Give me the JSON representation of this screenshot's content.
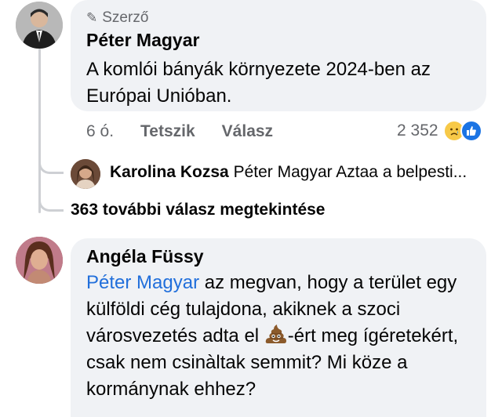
{
  "comments": [
    {
      "badge": "Szerző",
      "author": "Péter Magyar",
      "text": "A komlói bányák környezete 2024-ben az Európai Unióban.",
      "time": "6 ó.",
      "like_label": "Tetszik",
      "reply_label": "Válasz",
      "reaction_count": "2 352",
      "reactions": [
        "sad-icon",
        "like-icon"
      ],
      "reply_preview": {
        "author": "Karolina Kozsa",
        "text": "Péter Magyar Aztaa a belpesti..."
      },
      "more_replies": "363 további válasz megtekintése"
    },
    {
      "author": "Angéla Füssy",
      "mention": "Péter Magyar",
      "text_part1": " az megvan, hogy a terület egy külföldi cég tulajdona, akiknek a szoci városvezetés adta el ",
      "text_part2": "-ért meg ígéretekért, csak nem csinàltak semmit? Mi köze a kormánynak ehhez?"
    }
  ],
  "colors": {
    "bubble": "#f0f2f5",
    "mention": "#216fdb",
    "secondary_text": "#65676b",
    "thread_line": "#ced0d4"
  }
}
